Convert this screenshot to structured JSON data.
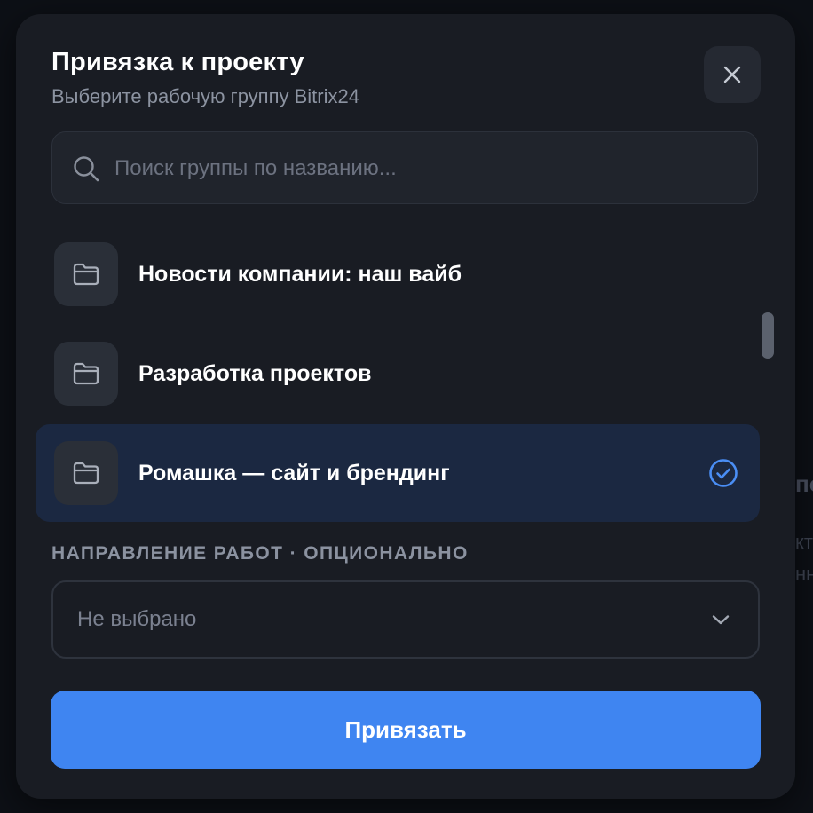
{
  "background_peek": {
    "line1": "по",
    "line2": "кто",
    "line3": "нн"
  },
  "modal": {
    "title": "Привязка к проекту",
    "subtitle": "Выберите рабочую группу Bitrix24",
    "close_icon": "close-icon"
  },
  "search": {
    "icon": "search-icon",
    "placeholder": "Поиск группы по названию...",
    "value": ""
  },
  "groups": [
    {
      "label": "Новости компании: наш вайб",
      "icon": "folder-icon",
      "selected": false
    },
    {
      "label": "Разработка проектов",
      "icon": "folder-icon",
      "selected": false
    },
    {
      "label": "Ромашка — сайт и брендинг",
      "icon": "folder-icon",
      "selected": true,
      "selected_icon": "check-circle-icon"
    }
  ],
  "direction": {
    "label": "НАПРАВЛЕНИЕ РАБОТ · ОПЦИОНАЛЬНО",
    "selected_value": "Не выбрано",
    "icon": "chevron-down-icon"
  },
  "submit": {
    "label": "Привязать"
  },
  "colors": {
    "accent": "#3f85f1",
    "selected_row": "#1b2841",
    "modal_bg": "#191c23",
    "check": "#4a8ef5"
  }
}
